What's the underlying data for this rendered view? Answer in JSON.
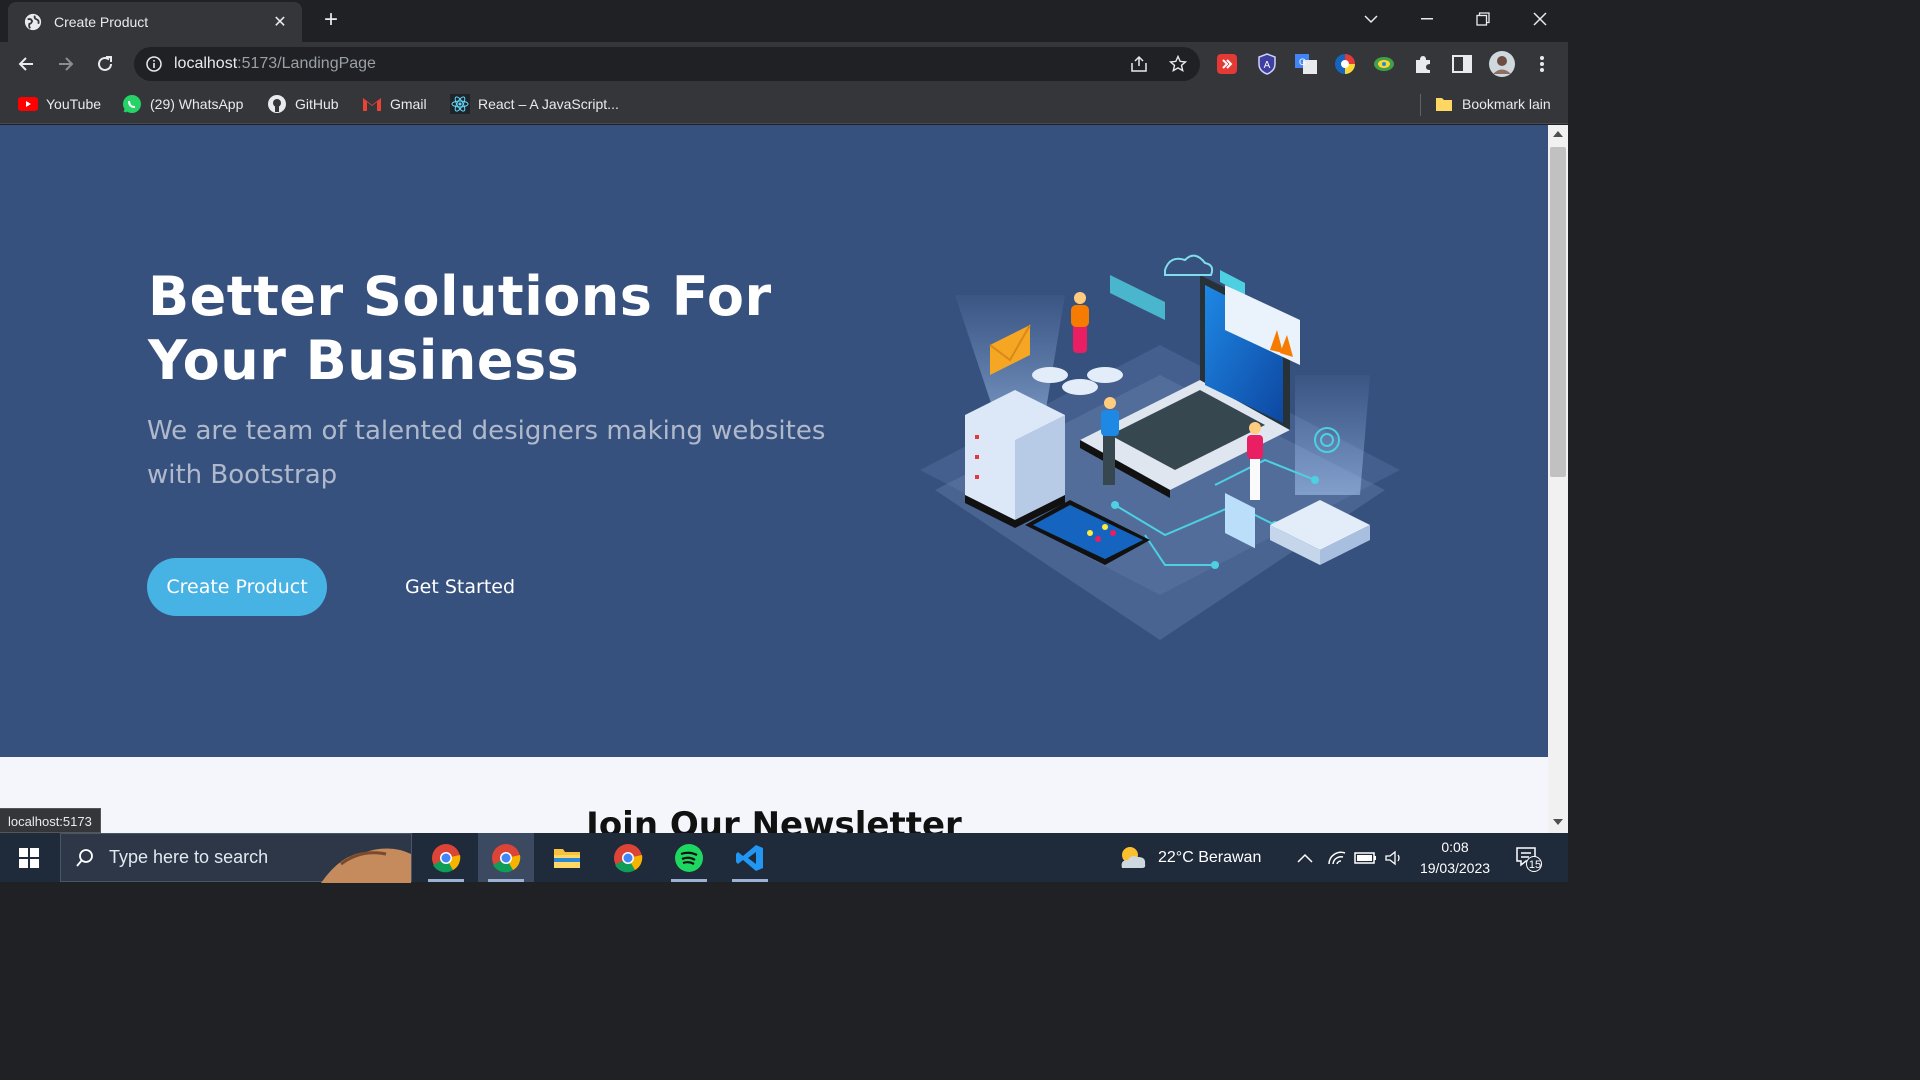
{
  "browser": {
    "tab_title": "Create Product",
    "url_host": "localhost",
    "url_path": ":5173/LandingPage",
    "status_url": "localhost:5173",
    "bookmarks": [
      {
        "label": "YouTube",
        "icon": "youtube-icon"
      },
      {
        "label": "(29) WhatsApp",
        "icon": "whatsapp-icon"
      },
      {
        "label": "GitHub",
        "icon": "github-icon"
      },
      {
        "label": "Gmail",
        "icon": "gmail-icon"
      },
      {
        "label": "React – A JavaScript...",
        "icon": "react-icon"
      }
    ],
    "other_bookmarks": "Bookmark lain"
  },
  "hero": {
    "title": "Better Solutions For Your Business",
    "subtitle": "We are team of talented designers making websites with Bootstrap",
    "primary_button": "Create Product",
    "secondary_button": "Get Started",
    "bg_color": "#37517e",
    "accent_color": "#47b2e4"
  },
  "newsletter": {
    "heading": "Join Our Newsletter"
  },
  "taskbar": {
    "search_placeholder": "Type here to search",
    "weather": "22°C  Berawan",
    "time": "0:08",
    "date": "19/03/2023",
    "notification_count": "15"
  }
}
